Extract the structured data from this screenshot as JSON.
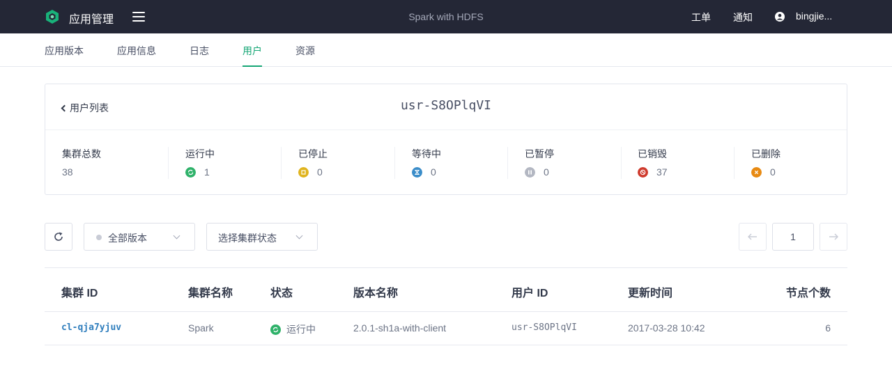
{
  "header": {
    "app_title": "应用管理",
    "center_title": "Spark with HDFS",
    "tickets": "工单",
    "notifications": "通知",
    "username": "bingjie..."
  },
  "tabs": [
    {
      "label": "应用版本"
    },
    {
      "label": "应用信息"
    },
    {
      "label": "日志"
    },
    {
      "label": "用户",
      "active": true
    },
    {
      "label": "资源"
    }
  ],
  "card": {
    "back_label": "用户列表",
    "user_id": "usr-S8OPlqVI",
    "stats": [
      {
        "label": "集群总数",
        "value": "38",
        "icon": "none"
      },
      {
        "label": "运行中",
        "value": "1",
        "icon": "running-icon",
        "color": "#2fb26a"
      },
      {
        "label": "已停止",
        "value": "0",
        "icon": "stopped-icon",
        "color": "#e0b41e"
      },
      {
        "label": "等待中",
        "value": "0",
        "icon": "pending-icon",
        "color": "#3b8dc9"
      },
      {
        "label": "已暂停",
        "value": "0",
        "icon": "suspended-icon",
        "color": "#b3b7c2"
      },
      {
        "label": "已销毁",
        "value": "37",
        "icon": "ceased-icon",
        "color": "#cf3b2e"
      },
      {
        "label": "已删除",
        "value": "0",
        "icon": "deleted-icon",
        "color": "#e88a12"
      }
    ]
  },
  "toolbar": {
    "version_select": "全部版本",
    "status_select": "选择集群状态",
    "page": "1"
  },
  "table": {
    "columns": [
      "集群 ID",
      "集群名称",
      "状态",
      "版本名称",
      "用户 ID",
      "更新时间",
      "节点个数"
    ],
    "rows": [
      {
        "cluster_id": "cl-qja7yjuv",
        "name": "Spark",
        "status": "运行中",
        "version": "2.0.1-sh1a-with-client",
        "user_id": "usr-S8OPlqVI",
        "updated": "2017-03-28 10:42",
        "nodes": "6"
      }
    ]
  },
  "colors": {
    "topbar": "#242736",
    "accent": "#15a675",
    "link": "#2f7ebd"
  }
}
